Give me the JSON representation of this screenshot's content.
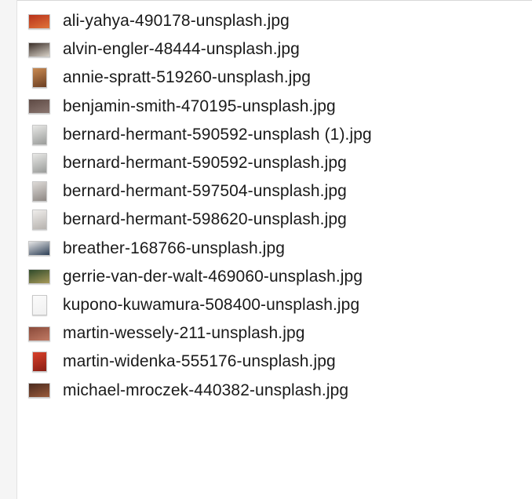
{
  "files": [
    {
      "name": "ali-yahya-490178-unsplash.jpg",
      "icon": "image-thumbnail-icon",
      "orientation": "landscape",
      "colors": [
        "#b8321a",
        "#e0743a"
      ]
    },
    {
      "name": "alvin-engler-48444-unsplash.jpg",
      "icon": "image-thumbnail-icon",
      "orientation": "landscape",
      "colors": [
        "#3a2e28",
        "#d9d2c8"
      ]
    },
    {
      "name": "annie-spratt-519260-unsplash.jpg",
      "icon": "image-thumbnail-icon",
      "orientation": "portrait",
      "colors": [
        "#c98a52",
        "#6b3f22"
      ]
    },
    {
      "name": "benjamin-smith-470195-unsplash.jpg",
      "icon": "image-thumbnail-icon",
      "orientation": "landscape",
      "colors": [
        "#5e4a44",
        "#8a7670"
      ]
    },
    {
      "name": "bernard-hermant-590592-unsplash (1).jpg",
      "icon": "image-thumbnail-icon",
      "orientation": "portrait",
      "colors": [
        "#e8e8e6",
        "#9a9c9a"
      ]
    },
    {
      "name": "bernard-hermant-590592-unsplash.jpg",
      "icon": "image-thumbnail-icon",
      "orientation": "portrait",
      "colors": [
        "#e8e8e6",
        "#9a9c9a"
      ]
    },
    {
      "name": "bernard-hermant-597504-unsplash.jpg",
      "icon": "image-thumbnail-icon",
      "orientation": "portrait",
      "colors": [
        "#dedbd8",
        "#8e8884"
      ]
    },
    {
      "name": "bernard-hermant-598620-unsplash.jpg",
      "icon": "image-thumbnail-icon",
      "orientation": "portrait",
      "colors": [
        "#efedeb",
        "#b6b2ae"
      ]
    },
    {
      "name": "breather-168766-unsplash.jpg",
      "icon": "image-thumbnail-icon",
      "orientation": "landscape",
      "colors": [
        "#e6e6e6",
        "#2c3e55"
      ]
    },
    {
      "name": "gerrie-van-der-walt-469060-unsplash.jpg",
      "icon": "image-thumbnail-icon",
      "orientation": "landscape",
      "colors": [
        "#2f4a2a",
        "#a89a5a"
      ]
    },
    {
      "name": "kupono-kuwamura-508400-unsplash.jpg",
      "icon": "image-thumbnail-icon",
      "orientation": "portrait",
      "colors": [
        "#fbfbfb",
        "#f0f0f0"
      ]
    },
    {
      "name": "martin-wessely-211-unsplash.jpg",
      "icon": "image-thumbnail-icon",
      "orientation": "landscape",
      "colors": [
        "#8a4a3a",
        "#c07a64"
      ]
    },
    {
      "name": "martin-widenka-555176-unsplash.jpg",
      "icon": "image-thumbnail-icon",
      "orientation": "portrait",
      "colors": [
        "#d8402a",
        "#8a1e14"
      ]
    },
    {
      "name": "michael-mroczek-440382-unsplash.jpg",
      "icon": "image-thumbnail-icon",
      "orientation": "landscape",
      "colors": [
        "#4a2a1e",
        "#9a5a3a"
      ]
    }
  ]
}
